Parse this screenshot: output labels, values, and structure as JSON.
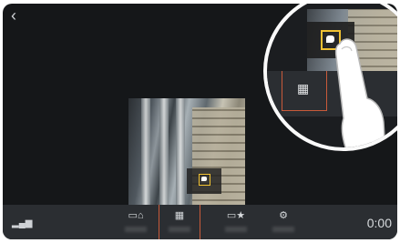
{
  "header": {
    "back_glyph": "‹"
  },
  "bottom_bar": {
    "time": "0:00",
    "items": [
      {
        "name": "home-view",
        "icon": "home-icon"
      },
      {
        "name": "apps",
        "icon": "grid-icon",
        "selected": true
      },
      {
        "name": "favorites",
        "icon": "star-icon"
      },
      {
        "name": "settings",
        "icon": "settings-icon"
      }
    ]
  },
  "callout": {
    "shows": "zoomed tap on selected grid button"
  },
  "colors": {
    "highlight": "#f1c232",
    "selection": "#c95a3a",
    "bar": "#2b2e32"
  }
}
